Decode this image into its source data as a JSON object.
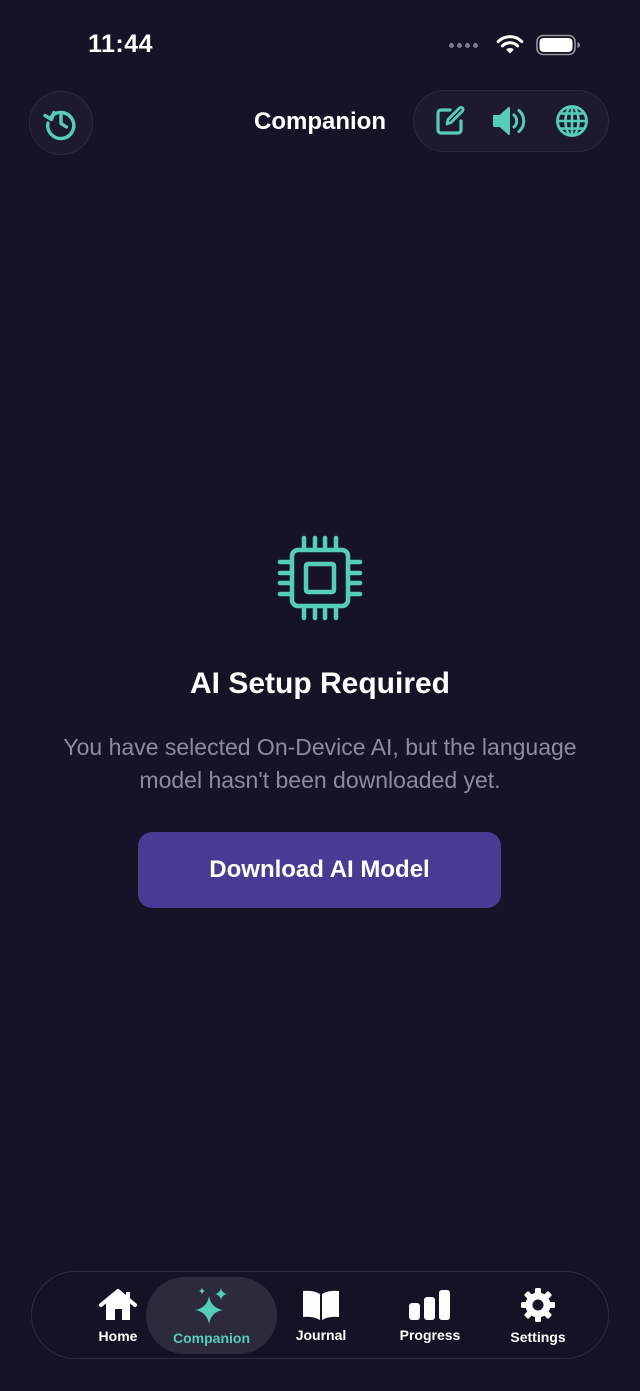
{
  "status_bar": {
    "time": "11:44"
  },
  "header": {
    "title": "Companion",
    "actions": [
      "new-chat",
      "speaker",
      "language"
    ]
  },
  "empty_state": {
    "title": "AI Setup Required",
    "description": "You have selected On-Device AI, but the language model hasn't been downloaded yet.",
    "button_label": "Download AI Model"
  },
  "tab_bar": {
    "active": "Companion",
    "tabs": [
      {
        "label": "Home",
        "icon": "house-icon"
      },
      {
        "label": "Companion",
        "icon": "sparkles-icon"
      },
      {
        "label": "Journal",
        "icon": "book-icon"
      },
      {
        "label": "Progress",
        "icon": "bar-chart-icon"
      },
      {
        "label": "Settings",
        "icon": "gear-icon"
      }
    ]
  },
  "colors": {
    "background": "#161326",
    "accent": "#56cdb8",
    "button": "#493a94",
    "muted_text": "#8e8ba0"
  }
}
